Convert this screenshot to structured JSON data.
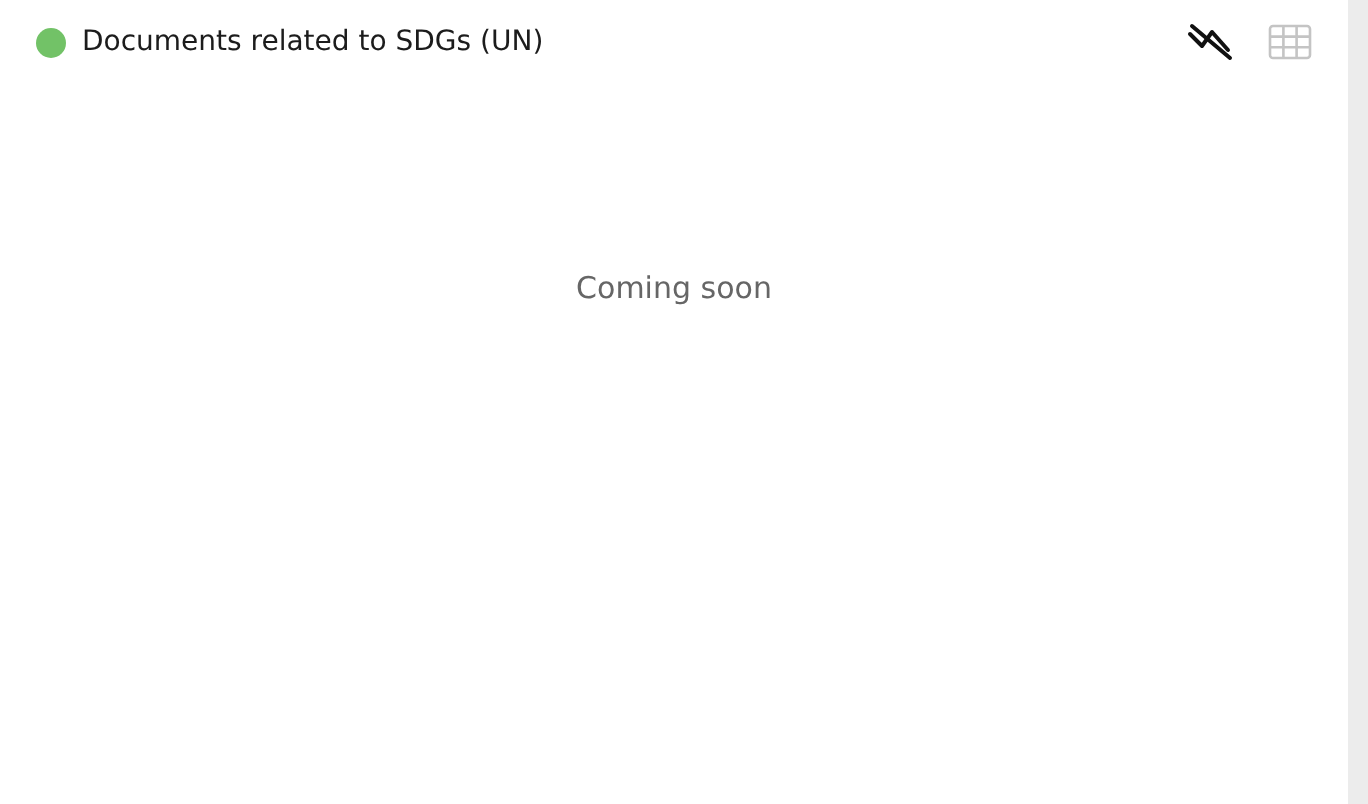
{
  "panel": {
    "title": "Documents related to SDGs (UN)",
    "color": "#72c267"
  },
  "view_toggles": [
    {
      "kind": "chart",
      "selected": true
    },
    {
      "kind": "table",
      "selected": false
    }
  ],
  "message": "Coming soon"
}
